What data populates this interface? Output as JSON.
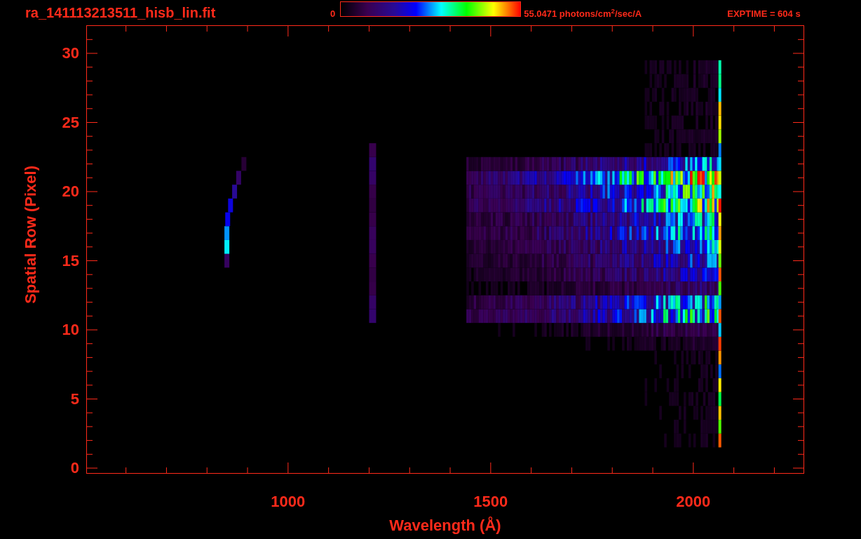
{
  "header": {
    "title": "ra_141113213511_hisb_lin.fit",
    "colorbar": {
      "min_label": "0",
      "max_label": "55.0471 photons/cm$^{2}$/sec/A"
    },
    "exposure": "EXPTIME = 604 s"
  },
  "plot": {
    "ylabel": "Spatial Row (Pixel)",
    "xlabel": "Wavelength (Å)",
    "yticks": [
      "30",
      "25",
      "20",
      "15",
      "10",
      "5",
      "0"
    ],
    "xticks": [
      "1000",
      "1500",
      "2000"
    ]
  }
}
